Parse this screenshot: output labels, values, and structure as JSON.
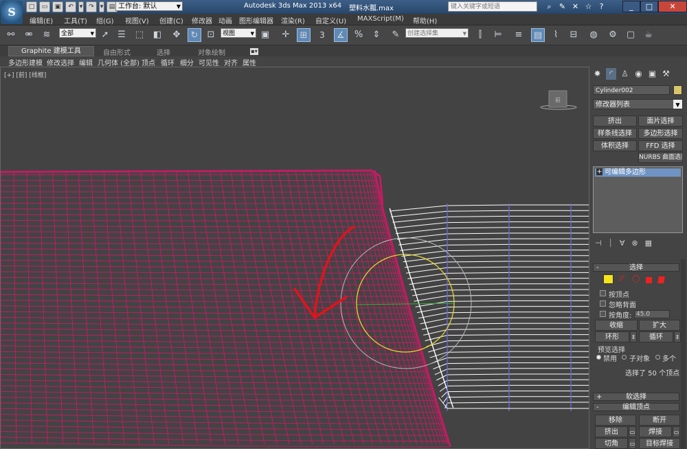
{
  "title_bar": {
    "app_title": "Autodesk 3ds Max  2013 x64",
    "file_title": "塑料水瓢.max",
    "workspace": "工作台: 默认",
    "search_placeholder": "键入关键字或短语",
    "app_icon_letter": "S"
  },
  "menu": [
    "编辑(E)",
    "工具(T)",
    "组(G)",
    "视图(V)",
    "创建(C)",
    "修改器",
    "动画",
    "图形编辑器",
    "渲染(R)",
    "自定义(U)",
    "MAXScript(M)",
    "帮助(H)"
  ],
  "toolbar": {
    "selection_filter": "全部",
    "reference_coord": "视图",
    "named_selection_placeholder": "创建选择集",
    "snap_label": "3",
    "percent_snap_label": "%"
  },
  "ribbon": {
    "tabs": [
      "Graphite 建模工具",
      "自由形式",
      "选择",
      "对象绘制"
    ],
    "buttons": [
      "多边形建模",
      "修改选择",
      "编辑",
      "几何体 (全部)",
      "顶点",
      "循环",
      "细分",
      "可见性",
      "对齐",
      "属性"
    ]
  },
  "viewport": {
    "label": "[+] [前] [线框]",
    "viewcube_label": "前"
  },
  "command_panel": {
    "object_name": "Cylinder002",
    "modifier_list": "修改器列表",
    "modifier_buttons": [
      "挤出",
      "面片选择",
      "样条线选择",
      "多边形选择",
      "体积选择",
      "FFD 选择",
      "NURBS 曲面选择"
    ],
    "stack_item": "可编辑多边形",
    "selection_rollout": {
      "title": "选择",
      "by_vertex": "按顶点",
      "ignore_backfacing": "忽略背面",
      "by_angle": "按角度:",
      "angle_value": "45.0",
      "shrink": "收缩",
      "grow": "扩大",
      "ring": "环形",
      "loop": "循环",
      "preview_title": "预览选择",
      "preview_options": [
        "禁用",
        "子对象",
        "多个"
      ],
      "status": "选择了 50 个顶点"
    },
    "soft_selection_title": "软选择",
    "edit_vertices": {
      "title": "编辑顶点",
      "buttons": [
        "移除",
        "断开",
        "挤出",
        "焊接",
        "切角",
        "目标焊接"
      ]
    }
  },
  "colors": {
    "mesh": "#c01d63",
    "selection_wire": "#ffffff",
    "edge_blue": "#6a6ad8",
    "gizmo_yellow": "#e6d630",
    "arrow_red": "#e0141a"
  }
}
